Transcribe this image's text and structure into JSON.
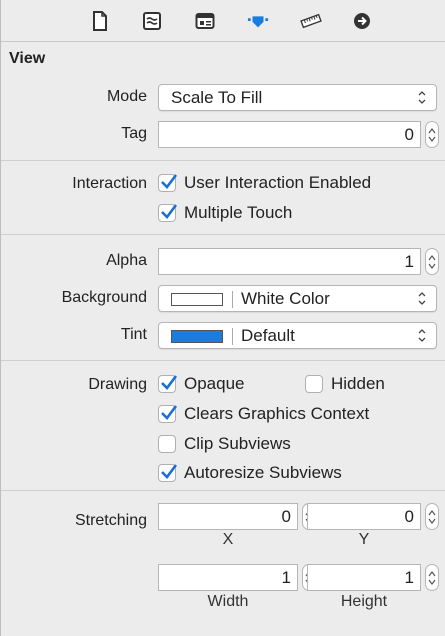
{
  "toolbar": {
    "icons": [
      "file-inspector-icon",
      "quick-help-icon",
      "identity-inspector-icon",
      "attributes-inspector-icon",
      "size-inspector-icon",
      "connections-inspector-icon"
    ]
  },
  "view": {
    "section_title": "View",
    "mode_label": "Mode",
    "mode_value": "Scale To Fill",
    "tag_label": "Tag",
    "tag_value": "0",
    "interaction_label": "Interaction",
    "user_interaction_label": "User Interaction Enabled",
    "user_interaction_checked": true,
    "multiple_touch_label": "Multiple Touch",
    "multiple_touch_checked": true,
    "alpha_label": "Alpha",
    "alpha_value": "1",
    "background_label": "Background",
    "background_value": "White Color",
    "background_color": "#ffffff",
    "tint_label": "Tint",
    "tint_value": "Default",
    "tint_color": "#1a7be0",
    "drawing_label": "Drawing",
    "opaque_label": "Opaque",
    "opaque_checked": true,
    "hidden_label": "Hidden",
    "hidden_checked": false,
    "clears_label": "Clears Graphics Context",
    "clears_checked": true,
    "clip_label": "Clip Subviews",
    "clip_checked": false,
    "autoresize_label": "Autoresize Subviews",
    "autoresize_checked": true,
    "stretching_label": "Stretching",
    "stretch_x_value": "0",
    "stretch_x_label": "X",
    "stretch_y_value": "0",
    "stretch_y_label": "Y",
    "stretch_width_value": "1",
    "stretch_width_label": "Width",
    "stretch_height_value": "1",
    "stretch_height_label": "Height"
  },
  "colors": {
    "accent": "#1a7be0",
    "check": "#1a6fd6"
  }
}
